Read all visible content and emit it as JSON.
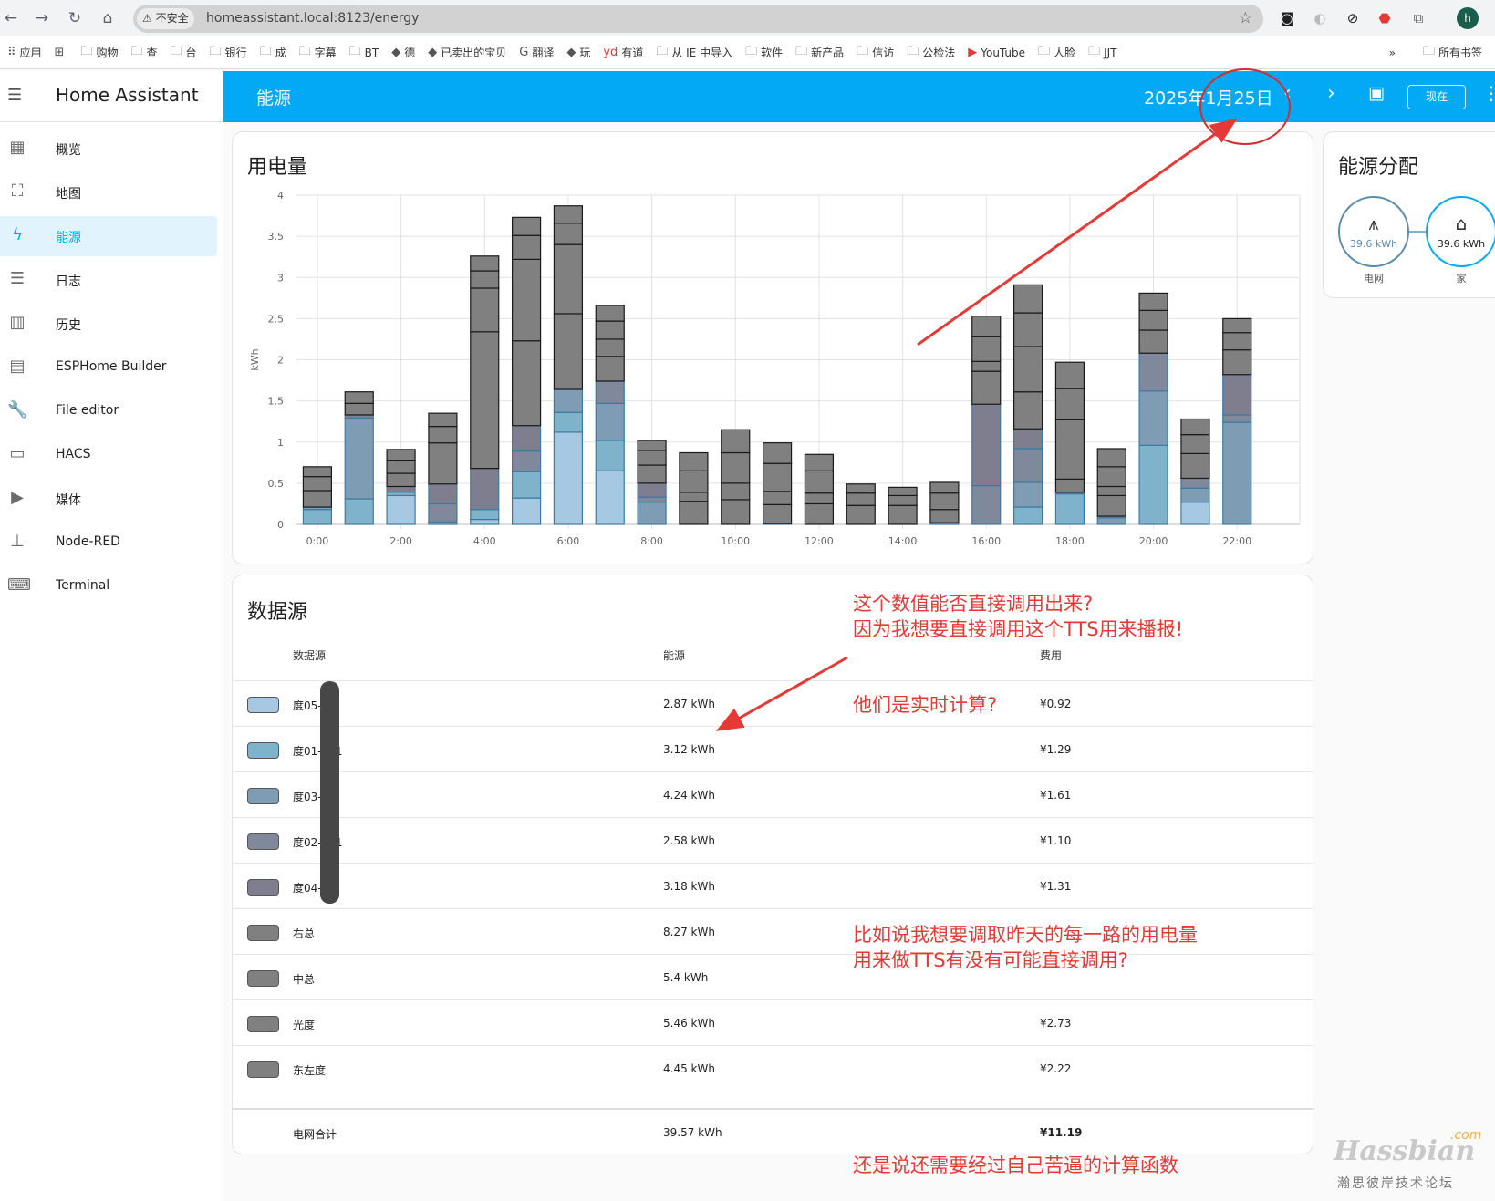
{
  "browser": {
    "security_label": "不安全",
    "url": "homeassistant.local:8123/energy",
    "avatar_letter": "h",
    "bookmarks": [
      {
        "label": "应用",
        "icon": "apps-grid-icon"
      },
      {
        "label": "",
        "icon": "grid-icon"
      },
      {
        "label": "购物",
        "icon": "folder-icon"
      },
      {
        "label": "查",
        "icon": "folder-icon"
      },
      {
        "label": "台",
        "icon": "folder-icon"
      },
      {
        "label": "银行",
        "icon": "folder-icon"
      },
      {
        "label": "成",
        "icon": "folder-icon"
      },
      {
        "label": "字幕",
        "icon": "folder-icon"
      },
      {
        "label": "BT",
        "icon": "folder-icon"
      },
      {
        "label": "德",
        "icon": "site-icon"
      },
      {
        "label": "已卖出的宝贝",
        "icon": "site-icon"
      },
      {
        "label": "翻译",
        "icon": "google-translate-icon"
      },
      {
        "label": "玩",
        "icon": "site-icon"
      },
      {
        "label": "有道",
        "icon": "youdao-icon"
      },
      {
        "label": "从 IE 中导入",
        "icon": "folder-icon"
      },
      {
        "label": "软件",
        "icon": "folder-icon"
      },
      {
        "label": "新产品",
        "icon": "folder-icon"
      },
      {
        "label": "信访",
        "icon": "folder-icon"
      },
      {
        "label": "公检法",
        "icon": "folder-icon"
      },
      {
        "label": "YouTube",
        "icon": "youtube-icon"
      },
      {
        "label": "人脸",
        "icon": "folder-icon"
      },
      {
        "label": "JJT",
        "icon": "folder-icon"
      }
    ],
    "more_bookmarks": "»",
    "all_bookmarks": "所有书签"
  },
  "sidebar": {
    "title": "Home Assistant",
    "items": [
      {
        "label": "概览",
        "icon": "dashboard-icon",
        "active": false
      },
      {
        "label": "地图",
        "icon": "map-account-icon",
        "active": false
      },
      {
        "label": "能源",
        "icon": "lightning-icon",
        "active": true
      },
      {
        "label": "日志",
        "icon": "list-icon",
        "active": false
      },
      {
        "label": "历史",
        "icon": "chart-box-icon",
        "active": false
      },
      {
        "label": "ESPHome Builder",
        "icon": "chip-icon",
        "active": false
      },
      {
        "label": "File editor",
        "icon": "wrench-icon",
        "active": false
      },
      {
        "label": "HACS",
        "icon": "hacs-store-icon",
        "active": false
      },
      {
        "label": "媒体",
        "icon": "play-box-icon",
        "active": false
      },
      {
        "label": "Node-RED",
        "icon": "sitemap-icon",
        "active": false
      },
      {
        "label": "Terminal",
        "icon": "console-icon",
        "active": false
      }
    ]
  },
  "header": {
    "title": "能源",
    "date": "2025年1月25日",
    "now_label": "现在",
    "accent": "#03a9f4"
  },
  "chart_data": {
    "type": "bar",
    "stacked": true,
    "title": "用电量",
    "ylabel": "kWh",
    "xlabel": "",
    "ylim": [
      0,
      4
    ],
    "yticks": [
      "0",
      "0.5",
      "1",
      "1.5",
      "2",
      "2.5",
      "3",
      "3.5",
      "4"
    ],
    "x": [
      "0:00",
      "1:00",
      "2:00",
      "3:00",
      "4:00",
      "5:00",
      "6:00",
      "7:00",
      "8:00",
      "9:00",
      "10:00",
      "11:00",
      "12:00",
      "13:00",
      "14:00",
      "15:00",
      "16:00",
      "17:00",
      "18:00",
      "19:00",
      "20:00",
      "21:00",
      "22:00",
      "23:00"
    ],
    "xtick_labels": [
      "0:00",
      "2:00",
      "4:00",
      "6:00",
      "8:00",
      "10:00",
      "12:00",
      "14:00",
      "16:00",
      "18:00",
      "20:00",
      "22:00"
    ],
    "grid": true,
    "series": [
      {
        "name": "度05",
        "color": "#a6c8e2",
        "values": [
          0,
          0,
          0.35,
          0,
          0.06,
          0.32,
          1.12,
          0.65,
          0,
          0,
          0,
          0,
          0,
          0,
          0,
          0,
          0,
          0,
          0,
          0,
          0,
          0.27,
          0,
          0
        ]
      },
      {
        "name": "度01",
        "color": "#7fb3cc",
        "values": [
          0.18,
          0.31,
          0.04,
          0.03,
          0.12,
          0.32,
          0.24,
          0.37,
          0,
          0,
          0,
          0,
          0,
          0,
          0,
          0,
          0,
          0.21,
          0.37,
          0,
          0.96,
          0,
          0,
          0
        ]
      },
      {
        "name": "度03",
        "color": "#7e9db4",
        "values": [
          0.03,
          0.98,
          0,
          0,
          0,
          0,
          0.28,
          0.45,
          0.27,
          0,
          0,
          0,
          0,
          0,
          0,
          0,
          0,
          0.3,
          0,
          0.08,
          0.66,
          0.17,
          1.24,
          0
        ]
      },
      {
        "name": "度02",
        "color": "#80889c",
        "values": [
          0,
          0,
          0,
          0.22,
          0,
          0.25,
          0,
          0.27,
          0.06,
          0,
          0,
          0,
          0,
          0,
          0,
          0,
          0.47,
          0.41,
          0,
          0,
          0.46,
          0.12,
          0.09,
          0
        ]
      },
      {
        "name": "度04",
        "color": "#7e7e8e",
        "values": [
          0,
          0.04,
          0.07,
          0.24,
          0.5,
          0.31,
          0,
          0,
          0.17,
          0,
          0,
          0.01,
          0,
          0,
          0,
          0.02,
          0.99,
          0.24,
          0.02,
          0.02,
          0,
          0,
          0.49,
          0
        ]
      },
      {
        "name": "右总",
        "color": "#808080",
        "values": [
          0.2,
          0.14,
          0.16,
          0.5,
          1.66,
          1.03,
          0.92,
          0.3,
          0.22,
          0.28,
          0.3,
          0.23,
          0.25,
          0.23,
          0.23,
          0.16,
          0.4,
          0.45,
          0.16,
          0.25,
          0.28,
          0.3,
          0.3,
          0
        ]
      },
      {
        "name": "中总",
        "color": "#808080",
        "values": [
          0.17,
          0.14,
          0.16,
          0.2,
          0.53,
          0.99,
          0.84,
          0.21,
          0.18,
          0.11,
          0.2,
          0.16,
          0.13,
          0.15,
          0.12,
          0.2,
          0.12,
          0.55,
          0.72,
          0.11,
          0.24,
          0.23,
          0.21,
          0
        ]
      },
      {
        "name": "光度",
        "color": "#808080",
        "values": [
          0.12,
          0,
          0.13,
          0.16,
          0.21,
          0.29,
          0.26,
          0.22,
          0.12,
          0.26,
          0.37,
          0.34,
          0.27,
          0.11,
          0.1,
          0.13,
          0.3,
          0.41,
          0.38,
          0.24,
          0.21,
          0.19,
          0.17,
          0
        ]
      },
      {
        "name": "东左度",
        "color": "#808080",
        "values": [
          0,
          0,
          0,
          0,
          0.18,
          0.22,
          0.21,
          0.19,
          0,
          0.22,
          0.28,
          0.25,
          0.2,
          0,
          0,
          0,
          0.25,
          0.34,
          0.32,
          0.22,
          0,
          0,
          0,
          0
        ]
      }
    ]
  },
  "distribution": {
    "title": "能源分配",
    "grid": {
      "label": "电网",
      "value": "39.6 kWh",
      "icon": "transmission-tower-icon"
    },
    "home": {
      "label": "家",
      "value": "39.6 kWh",
      "icon": "home-icon"
    }
  },
  "sources": {
    "title": "数据源",
    "columns": [
      "数据源",
      "能源",
      "费用"
    ],
    "rows": [
      {
        "name": "度05-",
        "energy": "2.87 kWh",
        "cost": "¥0.92",
        "color": "#a6c8e2"
      },
      {
        "name": "度01-    1",
        "energy": "3.12 kWh",
        "cost": "¥1.29",
        "color": "#7fb3cc"
      },
      {
        "name": "度03-",
        "energy": "4.24 kWh",
        "cost": "¥1.61",
        "color": "#7e9db4"
      },
      {
        "name": "度02-    1",
        "energy": "2.58 kWh",
        "cost": "¥1.10",
        "color": "#80889c"
      },
      {
        "name": "度04-",
        "energy": "3.18 kWh",
        "cost": "¥1.31",
        "color": "#7e7e8e"
      },
      {
        "name": "右总",
        "energy": "8.27 kWh",
        "cost": "",
        "color": "#808080"
      },
      {
        "name": "中总",
        "energy": "5.4 kWh",
        "cost": "",
        "color": "#808080"
      },
      {
        "name": "光度",
        "energy": "5.46 kWh",
        "cost": "¥2.73",
        "color": "#808080"
      },
      {
        "name": "东左度",
        "energy": "4.45 kWh",
        "cost": "¥2.22",
        "color": "#808080"
      }
    ],
    "total": {
      "name": "电网合计",
      "energy": "39.57 kWh",
      "cost": "¥11.19"
    }
  },
  "annotations": {
    "color": "#e53935",
    "note1_line1": "这个数值能否直接调用出来?",
    "note1_line2": "因为我想要直接调用这个TTS用来播报!",
    "note2": "他们是实时计算?",
    "note3_line1": "比如说我想要调取昨天的每一路的用电量",
    "note3_line2": "用来做TTS有没有可能直接调用?",
    "note4": "还是说还需要经过自己苦逼的计算函数"
  },
  "watermark": {
    "brand": "Hassbian",
    "suffix": ".com",
    "subtitle": "瀚思彼岸技术论坛"
  }
}
